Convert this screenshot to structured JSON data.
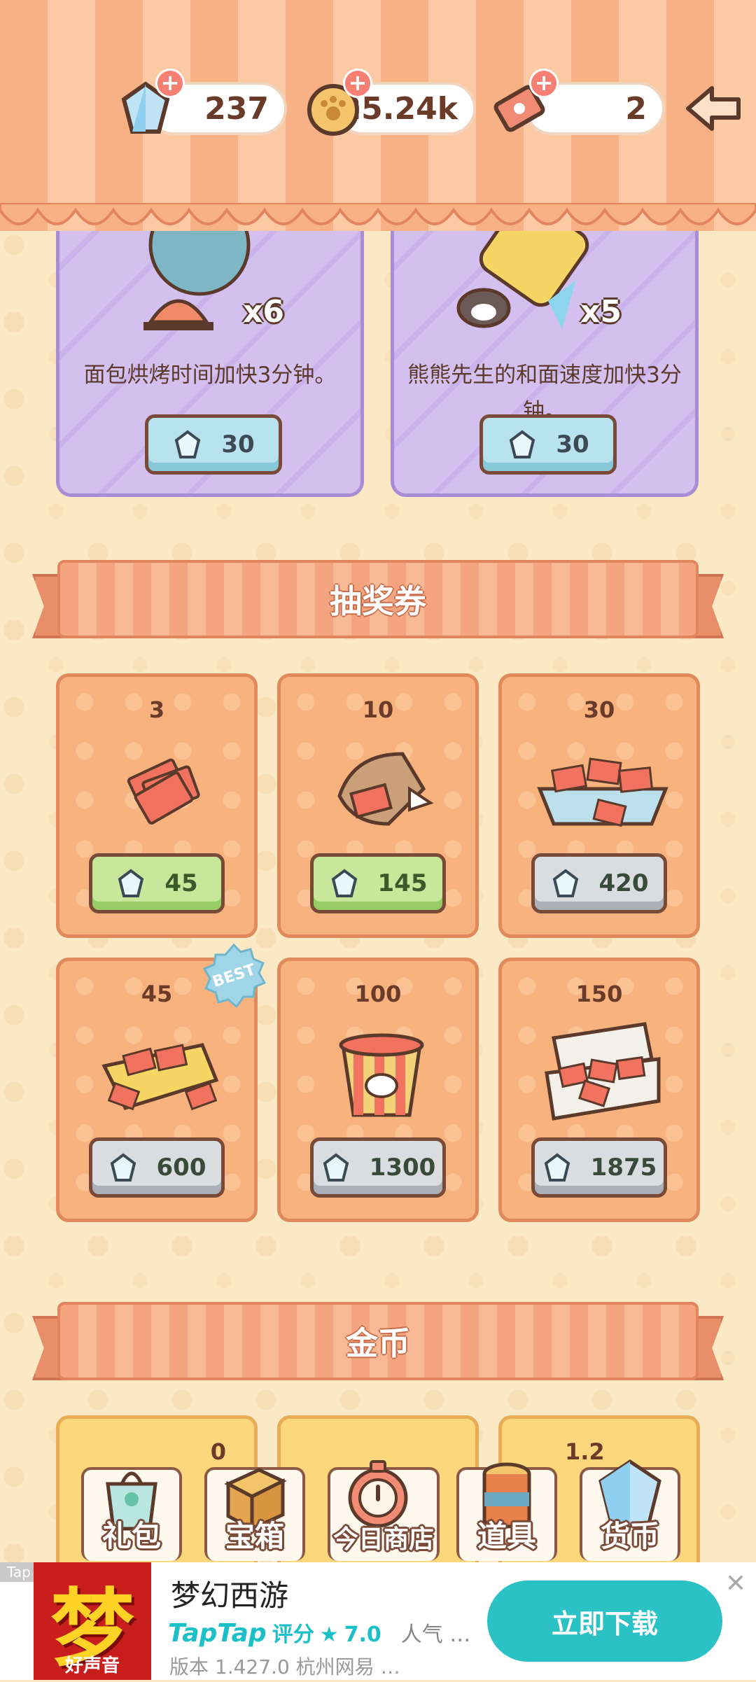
{
  "currency": {
    "gems": "237",
    "coins": "25.24k",
    "tickets": "2"
  },
  "boosts": [
    {
      "multiplier": "x6",
      "description": "面包烘烤时间加快3分钟。",
      "price": "30"
    },
    {
      "multiplier": "x5",
      "description": "熊熊先生的和面速度加快3分钟。",
      "price": "30"
    }
  ],
  "sections": {
    "tickets_title": "抽奖券",
    "coins_title": "金币"
  },
  "ticket_packs": [
    {
      "count": "3",
      "price": "45",
      "style": "green"
    },
    {
      "count": "10",
      "price": "145",
      "style": "green"
    },
    {
      "count": "30",
      "price": "420",
      "style": "grey"
    },
    {
      "count": "45",
      "price": "600",
      "style": "grey"
    },
    {
      "count": "100",
      "price": "1300",
      "style": "grey"
    },
    {
      "count": "150",
      "price": "1875",
      "style": "grey"
    }
  ],
  "best_badge": "BEST",
  "coin_packs": [
    {
      "partial_label": "0"
    },
    {
      "partial_label": ""
    },
    {
      "partial_label": "1.2"
    }
  ],
  "bottom_nav": [
    {
      "label": "礼包",
      "icon": "gift-bag-icon"
    },
    {
      "label": "宝箱",
      "icon": "treasure-chest-icon"
    },
    {
      "label": "今日商店",
      "icon": "daily-shop-icon"
    },
    {
      "label": "道具",
      "icon": "jar-icon"
    },
    {
      "label": "货币",
      "icon": "gem-icon"
    }
  ],
  "ad": {
    "tag": "Tap",
    "logo_glyph": "梦",
    "logo_sub": "好声音",
    "title": "梦幻西游",
    "brand": "TapTap",
    "rating_label": "评分",
    "rating_star": "★",
    "rating": "7.0",
    "popularity": "人气 …",
    "version": "版本 1.427.0  杭州网易 …",
    "cta": "立即下载",
    "close": "✕"
  },
  "colors": {
    "awning_dark": "#f7b184",
    "awning_light": "#fbcaa5",
    "boost_card": "#d4c0ee",
    "ticket_card": "#f7b27e",
    "price_green": "#c7e89a",
    "price_grey": "#d9dde0",
    "price_blue": "#b8e3ee",
    "ad_cta": "#2ac2c5"
  }
}
